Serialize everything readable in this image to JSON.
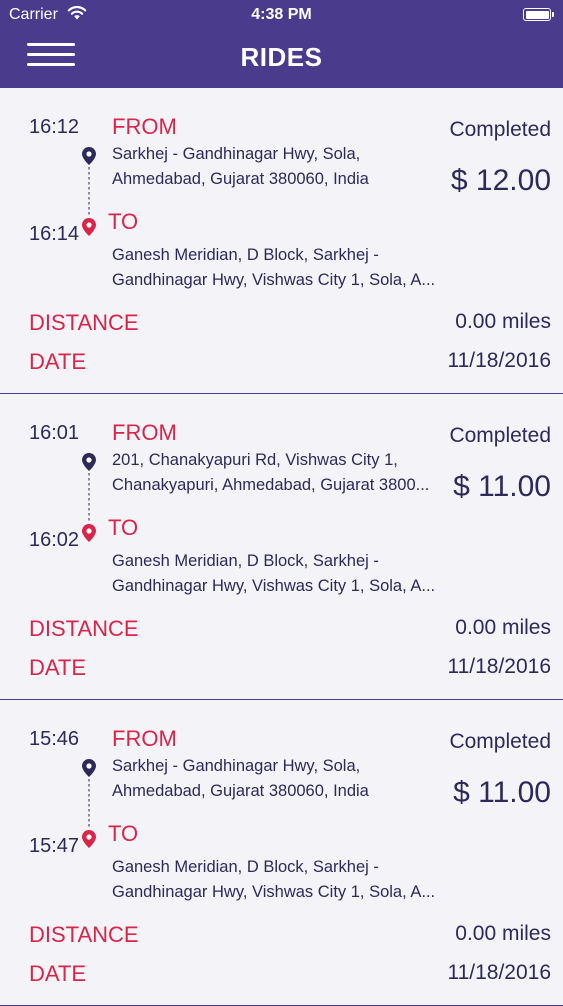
{
  "status_bar": {
    "carrier": "Carrier",
    "time": "4:38 PM"
  },
  "header": {
    "title": "RIDES",
    "menu_icon": "hamburger-menu-icon"
  },
  "labels": {
    "from": "FROM",
    "to": "TO",
    "distance": "DISTANCE",
    "date": "DATE"
  },
  "colors": {
    "header": "#4a3b8c",
    "accent": "#d8254a",
    "text": "#2d2a5a"
  },
  "rides": [
    {
      "start_time": "16:12",
      "end_time": "16:14",
      "from_lines": [
        "Sarkhej - Gandhinagar Hwy, Sola,",
        "Ahmedabad, Gujarat 380060, India"
      ],
      "to_lines": [
        "Ganesh Meridian, D Block, Sarkhej -",
        "Gandhinagar Hwy, Vishwas City 1, Sola, A..."
      ],
      "status": "Completed",
      "fare": "$ 12.00",
      "distance": "0.00 miles",
      "date": "11/18/2016"
    },
    {
      "start_time": "16:01",
      "end_time": "16:02",
      "from_lines": [
        "201, Chanakyapuri Rd, Vishwas City 1,",
        "Chanakyapuri, Ahmedabad, Gujarat 3800..."
      ],
      "to_lines": [
        "Ganesh Meridian, D Block, Sarkhej -",
        "Gandhinagar Hwy, Vishwas City 1, Sola, A..."
      ],
      "status": "Completed",
      "fare": "$ 11.00",
      "distance": "0.00 miles",
      "date": "11/18/2016"
    },
    {
      "start_time": "15:46",
      "end_time": "15:47",
      "from_lines": [
        "Sarkhej - Gandhinagar Hwy, Sola,",
        "Ahmedabad, Gujarat 380060, India"
      ],
      "to_lines": [
        "Ganesh Meridian, D Block, Sarkhej -",
        "Gandhinagar Hwy, Vishwas City 1, Sola, A..."
      ],
      "status": "Completed",
      "fare": "$ 11.00",
      "distance": "0.00 miles",
      "date": "11/18/2016"
    }
  ]
}
